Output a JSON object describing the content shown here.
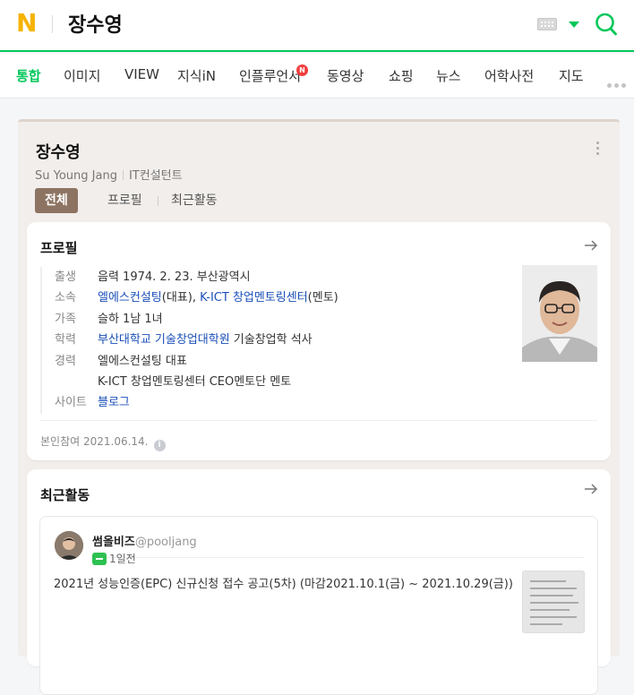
{
  "header": {
    "logo": "N",
    "query": "장수영",
    "colors": {
      "brand": "#03c75a",
      "logo": "#f6b300"
    },
    "icons": [
      "keyboard-icon",
      "dropdown-caret-icon",
      "search-icon"
    ]
  },
  "tabs": [
    {
      "label": "통합",
      "active": true
    },
    {
      "label": "이미지"
    },
    {
      "label": "VIEW"
    },
    {
      "label": "지식iN"
    },
    {
      "label": "인플루언서",
      "badge": "N"
    },
    {
      "label": "동영상"
    },
    {
      "label": "쇼핑"
    },
    {
      "label": "뉴스"
    },
    {
      "label": "어학사전"
    },
    {
      "label": "지도"
    }
  ],
  "person": {
    "name": "장수영",
    "english_name": "Su Young Jang",
    "occupation": "IT컨설턴트",
    "content_tabs": [
      "전체",
      "프로필",
      "최근활동"
    ]
  },
  "profile": {
    "title": "프로필",
    "rows": [
      {
        "key": "출생",
        "value": "음력 1974. 2. 23. 부산광역시"
      },
      {
        "key": "소속",
        "link1": "엘에스컨설팅",
        "text1": "(대표), ",
        "link2": "K-ICT 창업멘토링센터",
        "text2": "(멘토)"
      },
      {
        "key": "가족",
        "value": "슬하 1남 1녀"
      },
      {
        "key": "학력",
        "link1": "부산대학교 기술창업대학원",
        "text1": " 기술창업학 석사"
      },
      {
        "key": "경력",
        "value": "엘에스컨설팅 대표"
      },
      {
        "key": "",
        "value": "K-ICT 창업멘토링센터 CEO멘토단 멘토"
      },
      {
        "key": "사이트",
        "link1": "블로그"
      }
    ],
    "footer": "본인참여 2021.06.14."
  },
  "activity": {
    "title": "최근활동",
    "post": {
      "author": "썸올비즈",
      "handle": "@pooljang",
      "time": "1일전",
      "text": "2021년 성능인증(EPC) 신규신청 접수 공고(5차) (마감2021.10.1(금) ~ 2021.10.29(금))"
    }
  }
}
